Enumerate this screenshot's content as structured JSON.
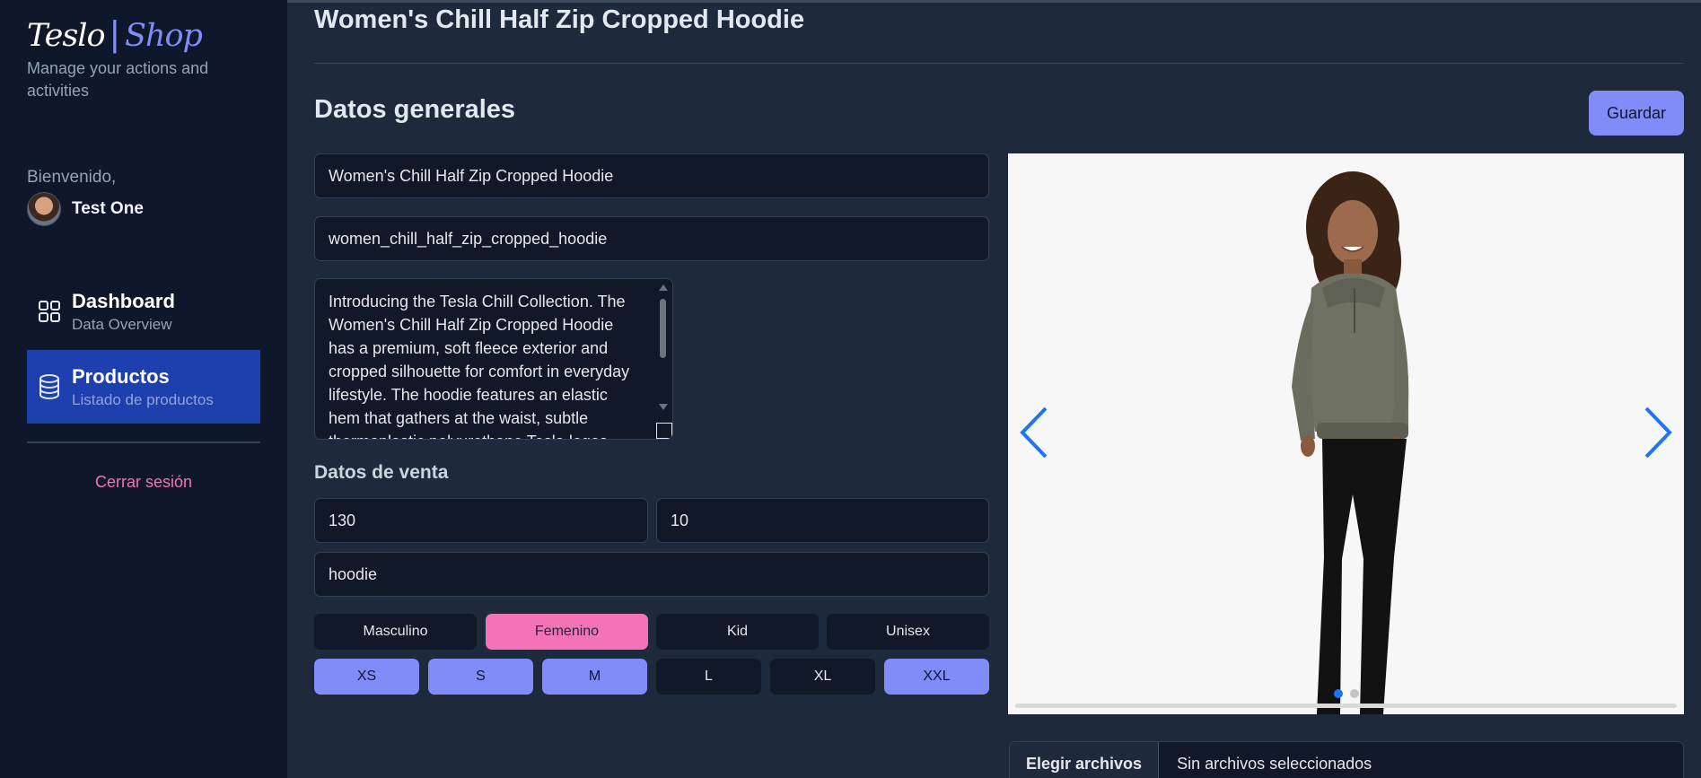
{
  "sidebar": {
    "logo_teslo": "Teslo",
    "logo_bar": "|",
    "logo_shop": "Shop",
    "tagline": "Manage your actions and activities",
    "welcome": "Bienvenido,",
    "user_name": "Test One",
    "nav": [
      {
        "title": "Dashboard",
        "subtitle": "Data Overview",
        "icon": "grid-icon",
        "active": false
      },
      {
        "title": "Productos",
        "subtitle": "Listado de productos",
        "icon": "database-icon",
        "active": true
      }
    ],
    "logout": "Cerrar sesión"
  },
  "main": {
    "title": "Women's Chill Half Zip Cropped Hoodie",
    "section_title": "Datos generales",
    "save_label": "Guardar",
    "form": {
      "product_title": "Women's Chill Half Zip Cropped Hoodie",
      "slug": "women_chill_half_zip_cropped_hoodie",
      "description": "Introducing the Tesla Chill Collection. The Women's Chill Half Zip Cropped Hoodie has a premium, soft fleece exterior and cropped silhouette for comfort in everyday lifestyle. The hoodie features an elastic hem that gathers at the waist, subtle thermoplastic polyurethane Tesla logos along the hood",
      "sales_title": "Datos de venta",
      "price": "130",
      "stock": "10",
      "tags": "hoodie",
      "genders": [
        {
          "label": "Masculino",
          "active": false
        },
        {
          "label": "Femenino",
          "active": true
        },
        {
          "label": "Kid",
          "active": false
        },
        {
          "label": "Unisex",
          "active": false
        }
      ],
      "sizes": [
        {
          "label": "XS",
          "active": true
        },
        {
          "label": "S",
          "active": true
        },
        {
          "label": "M",
          "active": true
        },
        {
          "label": "L",
          "active": false
        },
        {
          "label": "XL",
          "active": false
        },
        {
          "label": "XXL",
          "active": true
        }
      ]
    },
    "carousel": {
      "slide_count": 2,
      "active_slide": 1
    },
    "file_input": {
      "button_label": "Elegir archivos",
      "status": "Sin archivos seleccionados"
    }
  },
  "colors": {
    "accent": "#818cf8",
    "active_nav": "#1e40af",
    "gender_active": "#f472b6",
    "logout": "#f472b6"
  }
}
